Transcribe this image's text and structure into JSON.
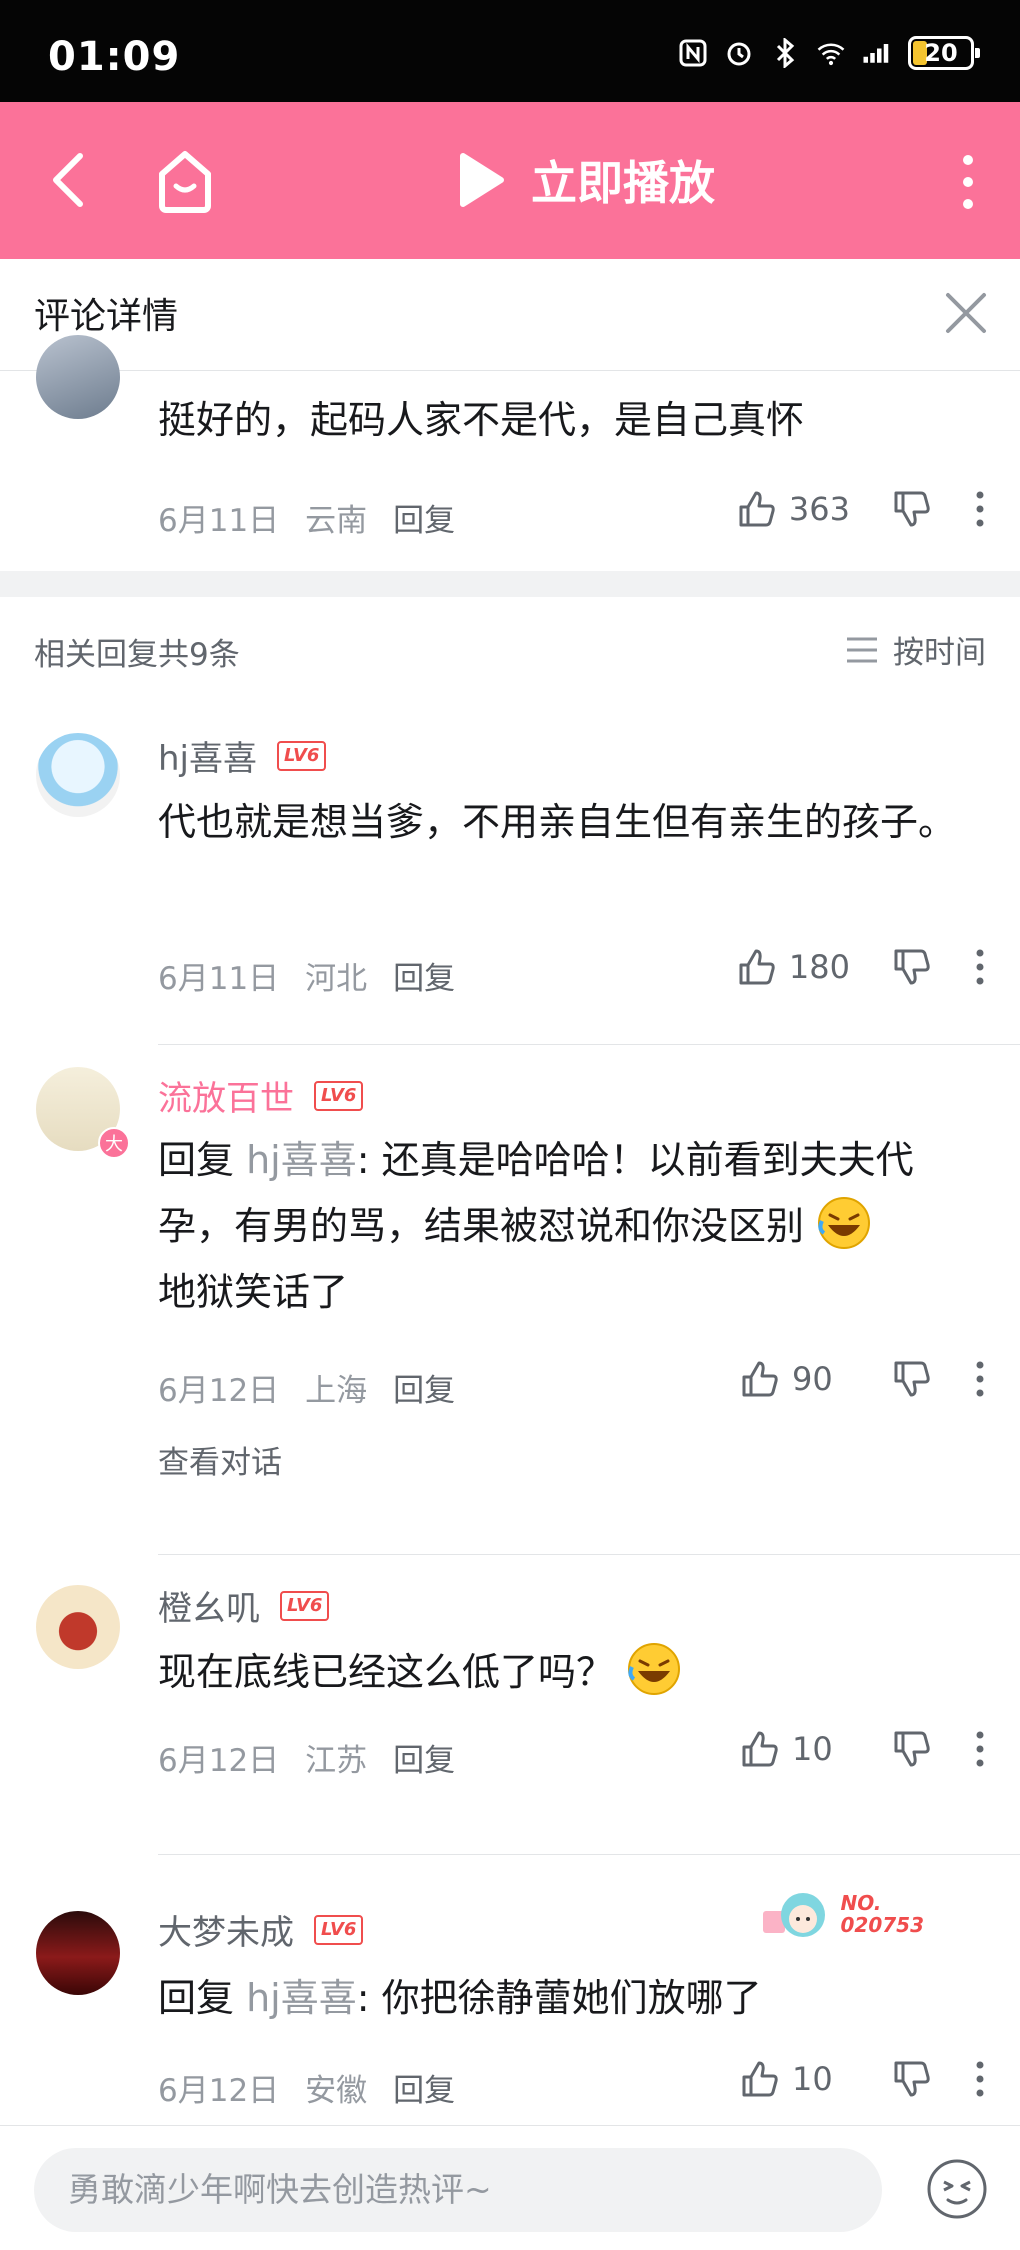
{
  "status_bar": {
    "time": "01:09",
    "battery": "20"
  },
  "topbar": {
    "play_label": "立即播放"
  },
  "detail": {
    "title": "评论详情"
  },
  "root_comment": {
    "text": "挺好的，起码人家不是代，是自己真怀",
    "date": "6月11日",
    "location": "云南",
    "reply_label": "回复",
    "likes": "363"
  },
  "related": {
    "count_label": "相关回复共9条",
    "sort_label": "按时间"
  },
  "replies": [
    {
      "user": "hj喜喜",
      "level": "LV6",
      "text": "代也就是想当爹，不用亲自生但有亲生的孩子。",
      "date": "6月11日",
      "location": "河北",
      "reply_label": "回复",
      "likes": "180"
    },
    {
      "user": "流放百世",
      "level": "LV6",
      "reply_prefix": "回复 ",
      "at_user": "hj喜喜",
      "text": ": 还真是哈哈哈！以前看到夫夫代孕，有男的骂，结果被怼说和你没区别",
      "text_after": "地狱笑话了",
      "date": "6月12日",
      "location": "上海",
      "reply_label": "回复",
      "likes": "90",
      "view_conversation": "查看对话",
      "avatar_badge": "大"
    },
    {
      "user": "橙幺叽",
      "level": "LV6",
      "text": "现在底线已经这么低了吗？",
      "date": "6月12日",
      "location": "江苏",
      "reply_label": "回复",
      "likes": "10"
    },
    {
      "user": "大梦未成",
      "level": "LV6",
      "reply_prefix": "回复 ",
      "at_user": "hj喜喜",
      "text": ": 你把徐静蕾她们放哪了",
      "date": "6月12日",
      "location": "安徽",
      "reply_label": "回复",
      "likes": "10",
      "fan_badge": "NO.\n020753"
    }
  ],
  "bottom": {
    "placeholder": "勇敢滴少年啊快去创造热评~"
  },
  "colors": {
    "brand": "#fb7299",
    "level": "#f04d4d"
  }
}
